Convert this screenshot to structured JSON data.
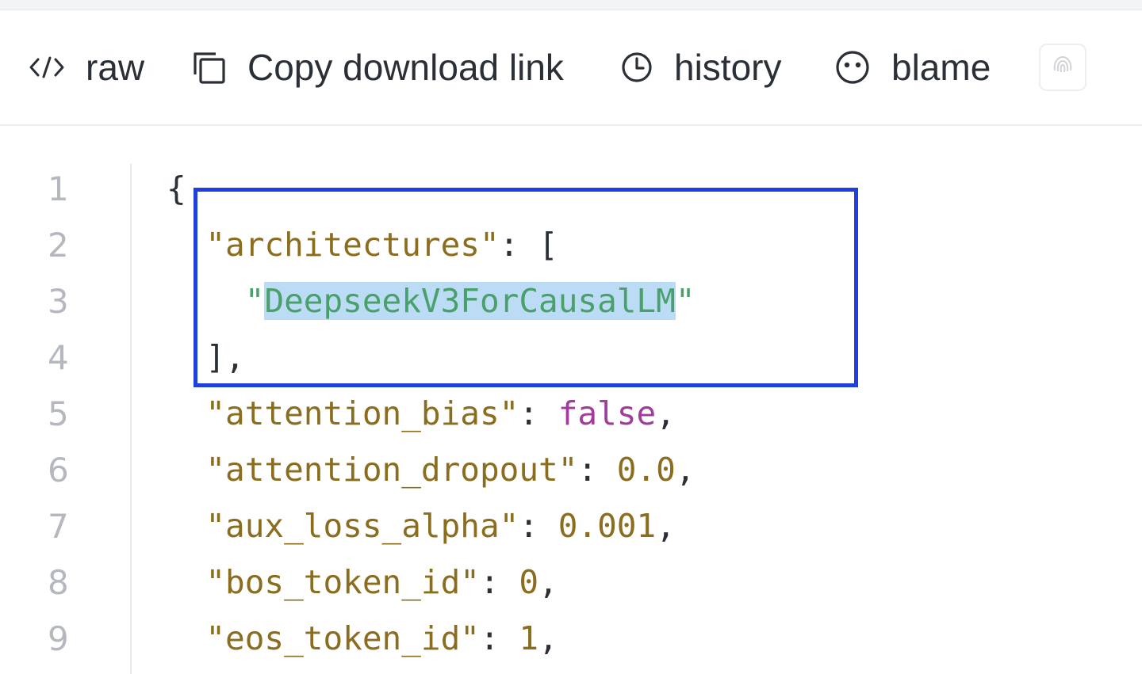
{
  "toolbar": {
    "raw_label": "raw",
    "raw_icon": "code-icon",
    "copy_label": "Copy download link",
    "copy_icon": "copy-icon",
    "history_label": "history",
    "history_icon": "clock-icon",
    "blame_label": "blame",
    "blame_icon": "face-icon",
    "extra_button_icon": "fingerprint-icon"
  },
  "colors": {
    "key": "#8a6d1e",
    "string": "#4aa06b",
    "boolean": "#a23b9b",
    "number": "#8a6d1e",
    "selection": "#bcdcf6",
    "highlight_box": "#1f3fe0"
  },
  "code": {
    "lines": [
      {
        "num": "1",
        "tokens": [
          {
            "t": "{",
            "c": "punc"
          }
        ]
      },
      {
        "num": "2",
        "tokens": [
          {
            "t": "  ",
            "c": "punc"
          },
          {
            "t": "\"architectures\"",
            "c": "key"
          },
          {
            "t": ": [",
            "c": "punc"
          }
        ]
      },
      {
        "num": "3",
        "tokens": [
          {
            "t": "    ",
            "c": "punc"
          },
          {
            "t": "\"",
            "c": "str"
          },
          {
            "t": "DeepseekV3ForCausalLM",
            "c": "str",
            "sel": true
          },
          {
            "t": "\"",
            "c": "str"
          }
        ]
      },
      {
        "num": "4",
        "tokens": [
          {
            "t": "  ",
            "c": "punc"
          },
          {
            "t": "],",
            "c": "punc"
          }
        ]
      },
      {
        "num": "5",
        "tokens": [
          {
            "t": "  ",
            "c": "punc"
          },
          {
            "t": "\"attention_bias\"",
            "c": "key"
          },
          {
            "t": ": ",
            "c": "punc"
          },
          {
            "t": "false",
            "c": "bool"
          },
          {
            "t": ",",
            "c": "punc"
          }
        ]
      },
      {
        "num": "6",
        "tokens": [
          {
            "t": "  ",
            "c": "punc"
          },
          {
            "t": "\"attention_dropout\"",
            "c": "key"
          },
          {
            "t": ": ",
            "c": "punc"
          },
          {
            "t": "0.0",
            "c": "num"
          },
          {
            "t": ",",
            "c": "punc"
          }
        ]
      },
      {
        "num": "7",
        "tokens": [
          {
            "t": "  ",
            "c": "punc"
          },
          {
            "t": "\"aux_loss_alpha\"",
            "c": "key"
          },
          {
            "t": ": ",
            "c": "punc"
          },
          {
            "t": "0.001",
            "c": "num"
          },
          {
            "t": ",",
            "c": "punc"
          }
        ]
      },
      {
        "num": "8",
        "tokens": [
          {
            "t": "  ",
            "c": "punc"
          },
          {
            "t": "\"bos_token_id\"",
            "c": "key"
          },
          {
            "t": ": ",
            "c": "punc"
          },
          {
            "t": "0",
            "c": "num"
          },
          {
            "t": ",",
            "c": "punc"
          }
        ]
      },
      {
        "num": "9",
        "tokens": [
          {
            "t": "  ",
            "c": "punc"
          },
          {
            "t": "\"eos_token_id\"",
            "c": "key"
          },
          {
            "t": ": ",
            "c": "punc"
          },
          {
            "t": "1",
            "c": "num"
          },
          {
            "t": ",",
            "c": "punc"
          }
        ]
      }
    ]
  }
}
